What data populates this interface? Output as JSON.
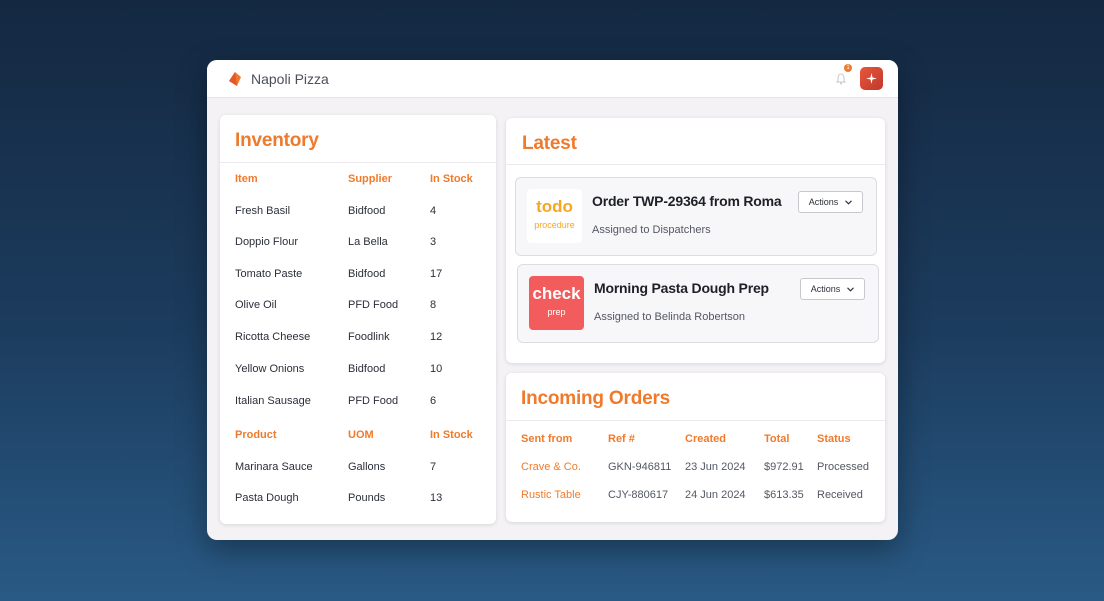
{
  "app": {
    "title": "Napoli Pizza",
    "notification_count": "1"
  },
  "colors": {
    "accent": "#f07a2b",
    "todo": "#f5a623",
    "check": "#f25c5c"
  },
  "inventory": {
    "title": "Inventory",
    "headers": [
      "Item",
      "Supplier",
      "In Stock"
    ],
    "rows": [
      [
        "Fresh Basil",
        "Bidfood",
        "4"
      ],
      [
        "Doppio Flour",
        "La Bella",
        "3"
      ],
      [
        "Tomato Paste",
        "Bidfood",
        "17"
      ],
      [
        "Olive Oil",
        "PFD Food",
        "8"
      ],
      [
        "Ricotta Cheese",
        "Foodlink",
        "12"
      ],
      [
        "Yellow Onions",
        "Bidfood",
        "10"
      ],
      [
        "Italian Sausage",
        "PFD Food",
        "6"
      ]
    ],
    "headers2": [
      "Product",
      "UOM",
      "In Stock"
    ],
    "rows2": [
      [
        "Marinara Sauce",
        "Gallons",
        "7"
      ],
      [
        "Pasta Dough",
        "Pounds",
        "13"
      ]
    ]
  },
  "latest": {
    "title": "Latest",
    "tasks": [
      {
        "badge_main": "todo",
        "badge_sub": "procedure",
        "title": "Order TWP-29364 from Roma",
        "subtitle": "Assigned to Dispatchers",
        "action_label": "Actions"
      },
      {
        "badge_main": "check",
        "badge_sub": "prep",
        "title": "Morning Pasta Dough Prep",
        "subtitle": "Assigned to Belinda Robertson",
        "action_label": "Actions"
      }
    ]
  },
  "orders": {
    "title": "Incoming Orders",
    "headers": [
      "Sent from",
      "Ref #",
      "Created",
      "Total",
      "Status"
    ],
    "rows": [
      [
        "Crave & Co.",
        "GKN-946811",
        "23 Jun 2024",
        "$972.91",
        "Processed"
      ],
      [
        "Rustic Table",
        "CJY-880617",
        "24 Jun 2024",
        "$613.35",
        "Received"
      ]
    ]
  }
}
